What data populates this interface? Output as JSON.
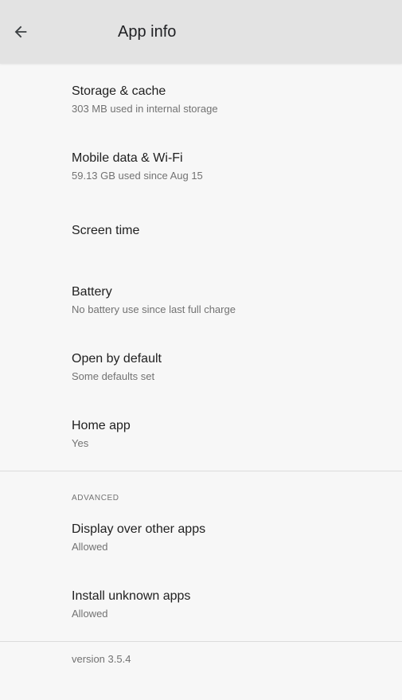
{
  "app_bar": {
    "title": "App info",
    "back_icon": "arrow-left-icon"
  },
  "items": [
    {
      "title": "Storage & cache",
      "summary": "303 MB used in internal storage"
    },
    {
      "title": "Mobile data & Wi-Fi",
      "summary": "59.13 GB used since Aug 15"
    },
    {
      "title": "Screen time",
      "summary": ""
    },
    {
      "title": "Battery",
      "summary": "No battery use since last full charge"
    },
    {
      "title": "Open by default",
      "summary": "Some defaults set"
    },
    {
      "title": "Home app",
      "summary": "Yes"
    }
  ],
  "advanced": {
    "header": "ADVANCED",
    "items": [
      {
        "title": "Display over other apps",
        "summary": "Allowed"
      },
      {
        "title": "Install unknown apps",
        "summary": "Allowed"
      }
    ]
  },
  "footer": {
    "version": "version 3.5.4"
  }
}
